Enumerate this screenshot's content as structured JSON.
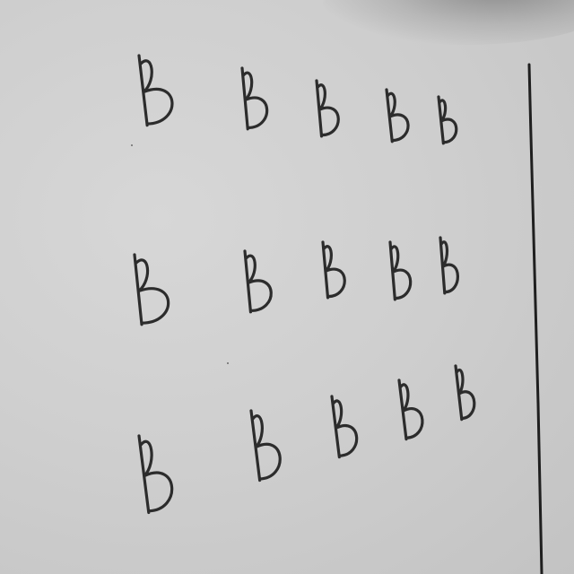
{
  "scene": {
    "description_free": true,
    "letter_glyph": "B",
    "rows": 3,
    "letters_per_row": 5,
    "colors": {
      "board": "#cfcfcf",
      "ink": "#2c2c2c"
    }
  }
}
